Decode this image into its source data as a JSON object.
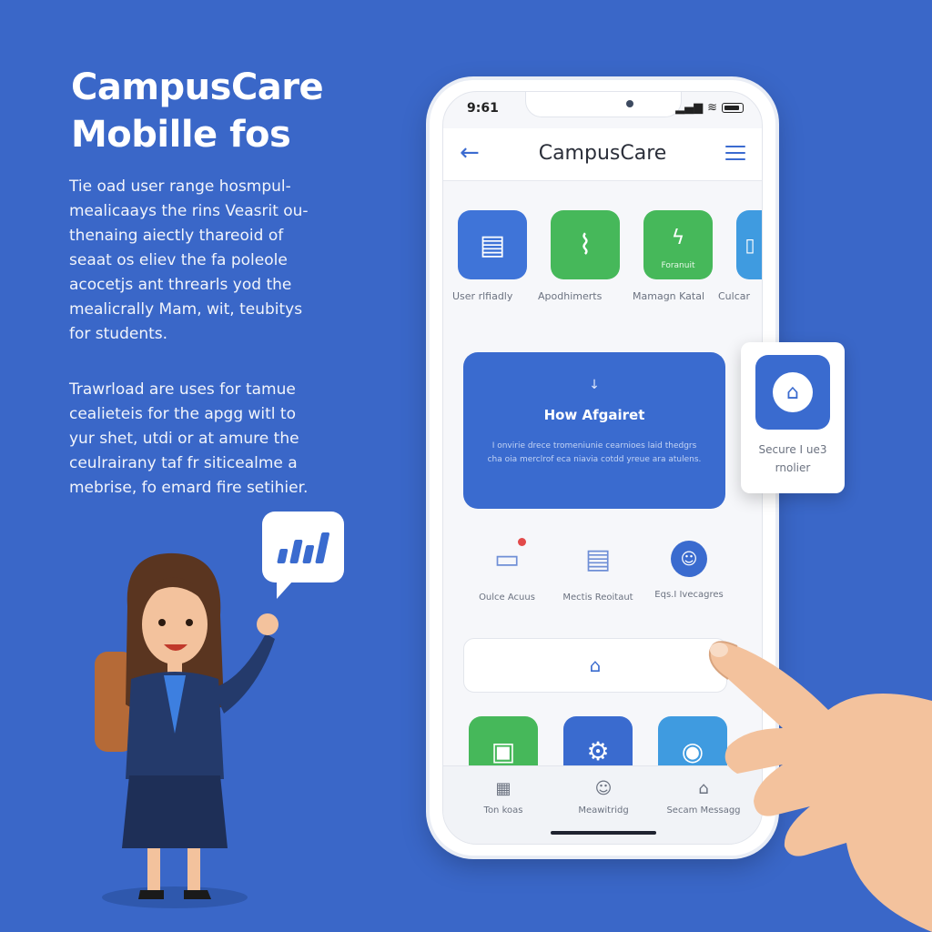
{
  "hero": {
    "title_line1": "CampusCare",
    "title_line2": "Mobille fos",
    "paragraph1": [
      "Tie oad user range hosmpul-",
      "mealicaays the rins Veasrit ou-",
      "thenaing aiectly thareoid of",
      "seaat os eliev the fa poleole",
      "acocetjs ant threarls yod the",
      "mealicrally Mam, wit, teubitys",
      "for students."
    ],
    "paragraph2": [
      "Trawrload are uses for tamue",
      "cealieteis for the apgg witl to",
      "yur shet, utdi or at amure the",
      "ceulrairany taf fr siticealme a",
      "mebrise, fo emard fire setihier."
    ]
  },
  "phone": {
    "status_time": "9:61",
    "status_icons": [
      "signal-icon",
      "wifi-icon",
      "battery-icon"
    ],
    "appbar": {
      "back_icon": "←",
      "title": "CampusCare",
      "menu_icon": "hamburger-icon"
    },
    "tiles": [
      {
        "name": "document-icon",
        "glyph": "▤",
        "color": "blue",
        "sub": ""
      },
      {
        "name": "heartbeat-icon",
        "glyph": "⌇",
        "color": "green",
        "sub": ""
      },
      {
        "name": "bolt-icon",
        "glyph": "ϟ",
        "color": "green",
        "sub": "Foranuit"
      },
      {
        "name": "partial-icon",
        "glyph": "▯",
        "color": "partial",
        "sub": ""
      }
    ],
    "tile_labels": [
      "User rlfiadly",
      "Apodhimerts",
      "Mamagn Katal",
      "Culcar"
    ],
    "banner": {
      "arrow": "↓",
      "title": "How Afgairet",
      "description": "I onvirie drece tromeniunie cearnioes laid thedgrs cha oia merclrof eca niavia cotdd yreue ara atulens."
    },
    "quick_actions": [
      {
        "icon": "inbox-icon",
        "glyph": "▭",
        "label": "Oulce Acuus"
      },
      {
        "icon": "report-icon",
        "glyph": "▤",
        "label": "Mectis Reoitaut"
      },
      {
        "icon": "user-circle-icon",
        "glyph": "☺",
        "label": "Eqs.I Ivecagres"
      }
    ],
    "home_icon": "⌂",
    "bottom_tiles": [
      {
        "icon": "chat-icon",
        "glyph": "▣",
        "color": "green"
      },
      {
        "icon": "gear-icon",
        "glyph": "⚙",
        "color": "blue"
      },
      {
        "icon": "car-icon",
        "glyph": "◉",
        "color": "teal"
      }
    ],
    "tabs": [
      {
        "icon": "calendar-icon",
        "glyph": "▦",
        "label": "Ton koas"
      },
      {
        "icon": "smile-icon",
        "glyph": "☺",
        "label": "Meawitridg"
      },
      {
        "icon": "lock-icon",
        "glyph": "⌂",
        "label": "Secam Messagg"
      }
    ]
  },
  "float_card": {
    "icon": "⌂",
    "label_line1": "Secure I ue3",
    "label_line2": "rnolier"
  },
  "colors": {
    "background": "#3a67c8",
    "accent_blue": "#3a6bcf",
    "accent_green": "#46b85a"
  }
}
